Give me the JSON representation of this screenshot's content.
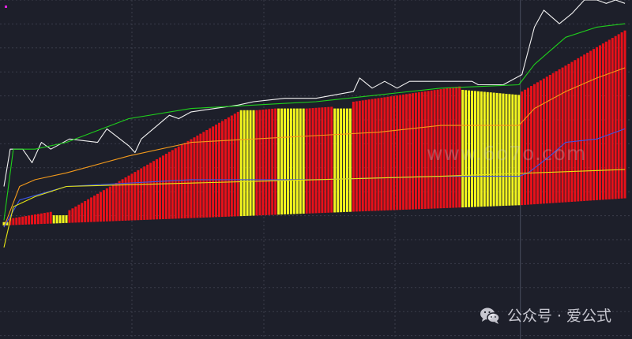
{
  "watermark": {
    "site": "www.6o7o.com",
    "account_text": "公众号 · 爱公式",
    "icon": "wechat-icon"
  },
  "colors": {
    "background": "#1d1f2a",
    "grid": "#3a3d4b",
    "bar_up": "#e8111a",
    "bar_flat": "#f3f61e",
    "price_line": "#f2f2f2",
    "upper_band": "#1fd01c",
    "mid_line": "#f39a1c",
    "ma_line": "#3d56e6",
    "lower_line": "#e6e613",
    "marker": "#e020e0"
  },
  "chart_data": {
    "type": "bar",
    "title": "",
    "xlabel": "",
    "ylabel": "",
    "grid": true,
    "legend": "none",
    "ylim": [
      0,
      100
    ],
    "period_divider_index": 166,
    "bar_count": 200,
    "bars": [
      {
        "from": 0,
        "to": 1,
        "top": 34.5,
        "color": "flat"
      },
      {
        "from": 2,
        "to": 15,
        "top_start": 35.5,
        "top_end": 37.5,
        "color": "up"
      },
      {
        "from": 16,
        "to": 20,
        "top": 36.5,
        "color": "flat"
      },
      {
        "from": 21,
        "to": 75,
        "top_start": 38.0,
        "top_end": 67.0,
        "color": "up"
      },
      {
        "from": 76,
        "to": 80,
        "top": 67.5,
        "color": "flat"
      },
      {
        "from": 81,
        "to": 87,
        "top_start": 67.5,
        "top_end": 68.0,
        "color": "up"
      },
      {
        "from": 88,
        "to": 96,
        "top": 68.0,
        "color": "flat"
      },
      {
        "from": 97,
        "to": 105,
        "top_start": 68.0,
        "top_end": 68.5,
        "color": "up"
      },
      {
        "from": 106,
        "to": 111,
        "top": 68.0,
        "color": "flat"
      },
      {
        "from": 112,
        "to": 146,
        "top_start": 70.0,
        "top_end": 74.5,
        "color": "up"
      },
      {
        "from": 147,
        "to": 165,
        "top_start": 73.5,
        "top_end": 72.0,
        "color": "flat"
      },
      {
        "from": 166,
        "to": 199,
        "top_start": 73.0,
        "top_end": 91.0,
        "color": "up"
      }
    ],
    "bar_bottom": [
      {
        "x": 0,
        "y": 33.5
      },
      {
        "x": 166,
        "y": 39.5
      },
      {
        "x": 199,
        "y": 41.5
      }
    ],
    "series": [
      {
        "key": "price_line",
        "points": [
          [
            0,
            45
          ],
          [
            2,
            56
          ],
          [
            6,
            56
          ],
          [
            9,
            52
          ],
          [
            12,
            58
          ],
          [
            15,
            56
          ],
          [
            21,
            59
          ],
          [
            30,
            58
          ],
          [
            33,
            62
          ],
          [
            40,
            57
          ],
          [
            42,
            55
          ],
          [
            44,
            59
          ],
          [
            53,
            66
          ],
          [
            56,
            65
          ],
          [
            60,
            67
          ],
          [
            75,
            69
          ],
          [
            80,
            70
          ],
          [
            90,
            71
          ],
          [
            100,
            71
          ],
          [
            112,
            73
          ],
          [
            114,
            77
          ],
          [
            118,
            74
          ],
          [
            122,
            76
          ],
          [
            126,
            74
          ],
          [
            130,
            76
          ],
          [
            137,
            76
          ],
          [
            145,
            76
          ],
          [
            150,
            76
          ],
          [
            152,
            75
          ],
          [
            160,
            75
          ],
          [
            166,
            78
          ],
          [
            170,
            92
          ],
          [
            173,
            97
          ],
          [
            178,
            93
          ],
          [
            182,
            96
          ],
          [
            186,
            100
          ],
          [
            190,
            100
          ],
          [
            193,
            99
          ],
          [
            196,
            100
          ],
          [
            199,
            99
          ]
        ]
      },
      {
        "key": "upper_band",
        "points": [
          [
            0,
            35
          ],
          [
            3,
            56
          ],
          [
            10,
            56
          ],
          [
            20,
            58
          ],
          [
            40,
            65
          ],
          [
            60,
            68
          ],
          [
            80,
            69
          ],
          [
            100,
            70
          ],
          [
            120,
            72
          ],
          [
            140,
            74
          ],
          [
            165,
            75
          ],
          [
            170,
            81
          ],
          [
            180,
            89
          ],
          [
            190,
            92
          ],
          [
            199,
            93
          ]
        ]
      },
      {
        "key": "mid_line",
        "points": [
          [
            0,
            33
          ],
          [
            5,
            45
          ],
          [
            10,
            47
          ],
          [
            20,
            49
          ],
          [
            40,
            54
          ],
          [
            60,
            58
          ],
          [
            80,
            59
          ],
          [
            100,
            60
          ],
          [
            120,
            61
          ],
          [
            140,
            63
          ],
          [
            165,
            63
          ],
          [
            170,
            68
          ],
          [
            180,
            73
          ],
          [
            190,
            77
          ],
          [
            199,
            80
          ]
        ]
      },
      {
        "key": "ma_line",
        "points": [
          [
            0,
            33
          ],
          [
            5,
            41
          ],
          [
            20,
            45
          ],
          [
            60,
            47
          ],
          [
            100,
            47
          ],
          [
            140,
            48
          ],
          [
            165,
            48
          ],
          [
            168,
            49
          ],
          [
            175,
            54
          ],
          [
            180,
            58
          ],
          [
            190,
            59
          ],
          [
            199,
            62
          ]
        ]
      },
      {
        "key": "lower_line",
        "points": [
          [
            0,
            27
          ],
          [
            3,
            39
          ],
          [
            10,
            42
          ],
          [
            20,
            45
          ],
          [
            60,
            46
          ],
          [
            100,
            47
          ],
          [
            140,
            48
          ],
          [
            199,
            50
          ]
        ]
      }
    ]
  }
}
